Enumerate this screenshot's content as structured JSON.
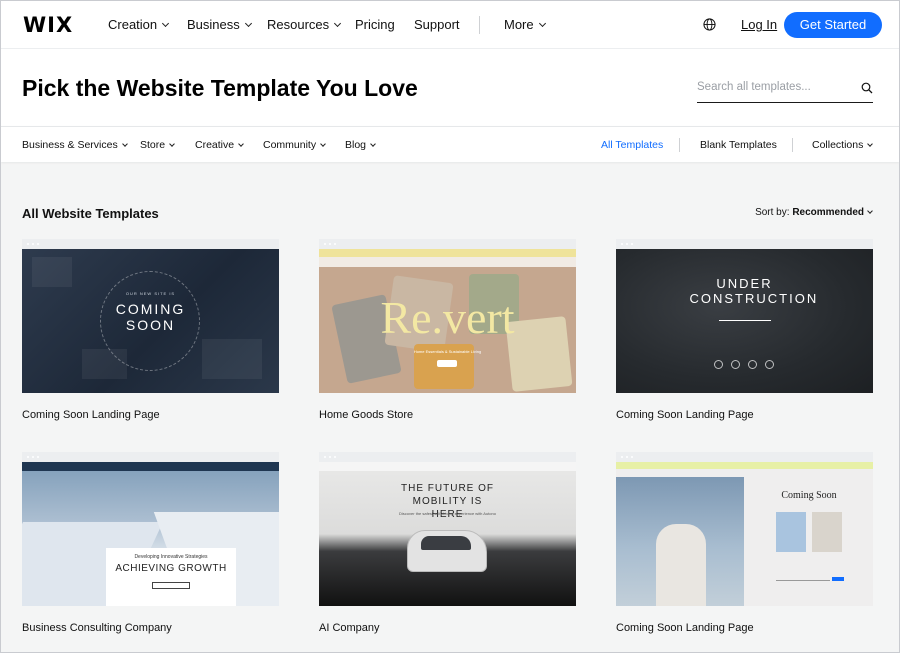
{
  "nav": {
    "logo": "WIX",
    "items": [
      {
        "label": "Creation",
        "has_dropdown": true
      },
      {
        "label": "Business",
        "has_dropdown": true
      },
      {
        "label": "Resources",
        "has_dropdown": true
      },
      {
        "label": "Pricing",
        "has_dropdown": false
      },
      {
        "label": "Support",
        "has_dropdown": false
      },
      {
        "label": "More",
        "has_dropdown": true
      }
    ],
    "globe_icon": "globe-icon",
    "login_label": "Log In",
    "cta_label": "Get Started"
  },
  "hero": {
    "title": "Pick the Website Template You Love",
    "search_placeholder": "Search all templates...",
    "search_icon": "search-icon"
  },
  "categories": {
    "left": [
      {
        "label": "Business & Services",
        "has_dropdown": true
      },
      {
        "label": "Store",
        "has_dropdown": true
      },
      {
        "label": "Creative",
        "has_dropdown": true
      },
      {
        "label": "Community",
        "has_dropdown": true
      },
      {
        "label": "Blog",
        "has_dropdown": true
      }
    ],
    "right": [
      {
        "label": "All Templates",
        "active": true
      },
      {
        "label": "Blank Templates",
        "active": false
      },
      {
        "label": "Collections",
        "has_dropdown": true
      }
    ]
  },
  "listing": {
    "title": "All Website Templates",
    "sort_prefix": "Sort by:",
    "sort_value": "Recommended"
  },
  "templates": [
    {
      "name": "Coming Soon Landing Page",
      "thumb_text": "COMING SOON",
      "thumb_kicker": "OUR NEW SITE IS"
    },
    {
      "name": "Home Goods Store",
      "thumb_text": "Re.vert",
      "thumb_sub": "Home Essentials & Sustainable Living"
    },
    {
      "name": "Coming Soon Landing Page",
      "thumb_text": "UNDER CONSTRUCTION"
    },
    {
      "name": "Business Consulting Company",
      "thumb_kicker": "Developing Innovative Strategies",
      "thumb_text": "ACHIEVING GROWTH"
    },
    {
      "name": "AI Company",
      "thumb_text": "THE FUTURE OF MOBILITY IS HERE",
      "thumb_sub": "Discover the safest self-driving experience with Autono"
    },
    {
      "name": "Coming Soon Landing Page",
      "thumb_text": "Coming Soon"
    }
  ],
  "colors": {
    "accent": "#116dff",
    "page_bg": "#f4f5f5"
  }
}
